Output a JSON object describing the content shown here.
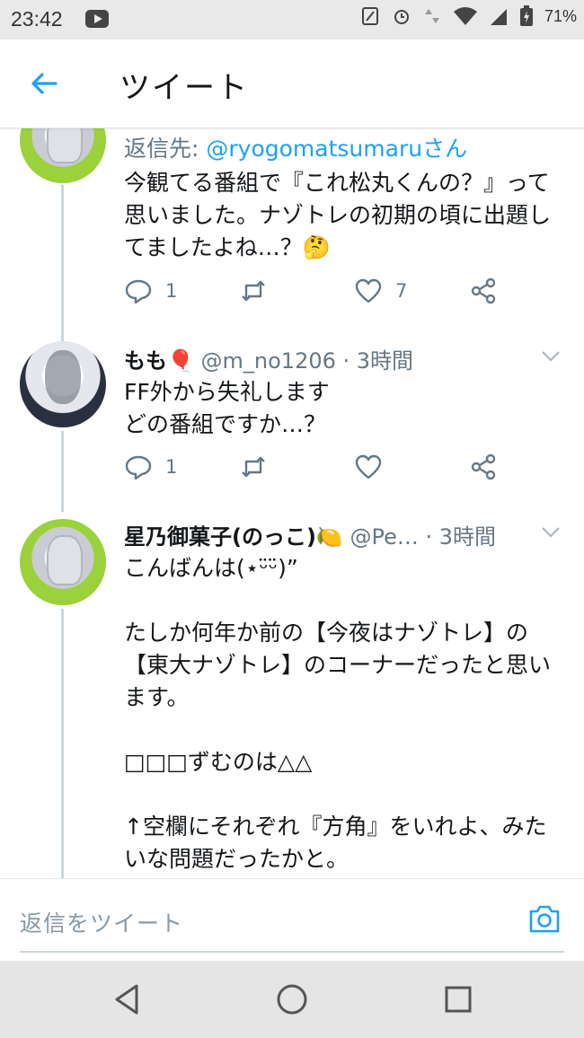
{
  "status_bar": {
    "time": "23:42",
    "battery": "71%",
    "icons": [
      "youtube-icon",
      "nfc-icon",
      "alarm-icon",
      "data-arrows-icon",
      "wifi-icon",
      "signal-icon",
      "battery-charging-icon"
    ]
  },
  "header": {
    "title": "ツイート",
    "back_icon": "arrow-left-icon"
  },
  "tweets": [
    {
      "reply_label": "返信先:",
      "reply_mention": "@ryogomatsumaru",
      "reply_suffix": "さん",
      "text": "今観てる番組で『これ松丸くんの？』って思いました。ナゾトレの初期の頃に出題してましたよね…？🤔",
      "actions": {
        "reply_count": "1",
        "retweet_count": "",
        "like_count": "7"
      }
    },
    {
      "name": "もも🎈",
      "handle": "@m_no1206",
      "time": "· 3時間",
      "text": "FF外から失礼します\nどの番組ですか…？",
      "actions": {
        "reply_count": "1",
        "retweet_count": "",
        "like_count": ""
      }
    },
    {
      "name": "星乃御菓子(のっこ)🍋",
      "handle": "@Pe…",
      "time": "· 3時間",
      "text": "こんばんは(⋆ᵕ̈ᵕ̈)”\n\nたしか何年か前の【今夜はナゾトレ】の【東大ナゾトレ】のコーナーだったと思います。\n\n□□□ずむのは△△\n\n↑空欄にそれぞれ『方角』をいれよ、みたいな問題だったかと。"
    }
  ],
  "composer": {
    "placeholder": "返信をツイート",
    "camera_icon": "camera-icon"
  },
  "nav_bar": {
    "icons": [
      "back-triangle-icon",
      "home-circle-icon",
      "recents-square-icon"
    ]
  },
  "colors": {
    "accent": "#1da1f2",
    "text": "#14171a",
    "muted": "#657786",
    "thread_line": "#ccd6dd",
    "like_heart": "#e0245e"
  }
}
